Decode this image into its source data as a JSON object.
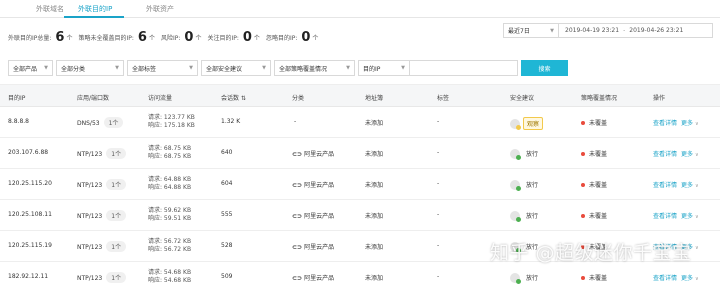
{
  "tabs": [
    "外联域名",
    "外联目的IP",
    "外联资产"
  ],
  "stats": [
    {
      "label": "外联目的IP总量:",
      "value": "6",
      "unit": "个"
    },
    {
      "label": "策略未全覆盖目的IP:",
      "value": "6",
      "unit": "个"
    },
    {
      "label": "风险IP:",
      "value": "0",
      "unit": "个"
    },
    {
      "label": "关注目的IP:",
      "value": "0",
      "unit": "个"
    },
    {
      "label": "忽略目的IP:",
      "value": "0",
      "unit": "个"
    }
  ],
  "date_range": {
    "preset": "最近7日",
    "start": "2019-04-19 23:21",
    "end": "2019-04-26 23:21",
    "separator": "-"
  },
  "filters": {
    "items": [
      "全部产品",
      "全部分类",
      "全部标签",
      "全部安全建议",
      "全部策略覆盖情况",
      "目的IP"
    ],
    "search_label": "搜索",
    "input_value": ""
  },
  "table": {
    "headers": [
      "目的IP",
      "应用/端口数",
      "访问流量",
      "会话数",
      "分类",
      "地址簿",
      "标签",
      "安全建议",
      "策略覆盖情况",
      "操作"
    ],
    "sort_icon": "⇅",
    "rows": [
      {
        "ip": "8.8.8.8",
        "app": "DNS/53",
        "count": "1个",
        "req": "请求:  123.77 KB",
        "resp": "响应:  175.18 KB",
        "sessions": "1.32 K",
        "category_icon": "",
        "category": "-",
        "address": "未添加",
        "tag": "-",
        "advice": "观察",
        "advice_type": "warn",
        "coverage": "未覆盖",
        "detail": "查看详情",
        "more": "更多"
      },
      {
        "ip": "203.107.6.88",
        "app": "NTP/123",
        "count": "1个",
        "req": "请求:  68.75 KB",
        "resp": "响应:  68.75 KB",
        "sessions": "640",
        "category_icon": "⊂⊃",
        "category": "阿里云产品",
        "address": "未添加",
        "tag": "-",
        "advice": "放行",
        "advice_type": "ok",
        "coverage": "未覆盖",
        "detail": "查看详情",
        "more": "更多"
      },
      {
        "ip": "120.25.115.20",
        "app": "NTP/123",
        "count": "1个",
        "req": "请求:  64.88 KB",
        "resp": "响应:  64.88 KB",
        "sessions": "604",
        "category_icon": "⊂⊃",
        "category": "阿里云产品",
        "address": "未添加",
        "tag": "-",
        "advice": "放行",
        "advice_type": "ok",
        "coverage": "未覆盖",
        "detail": "查看详情",
        "more": "更多"
      },
      {
        "ip": "120.25.108.11",
        "app": "NTP/123",
        "count": "1个",
        "req": "请求:  59.62 KB",
        "resp": "响应:  59.51 KB",
        "sessions": "555",
        "category_icon": "⊂⊃",
        "category": "阿里云产品",
        "address": "未添加",
        "tag": "-",
        "advice": "放行",
        "advice_type": "ok",
        "coverage": "未覆盖",
        "detail": "查看详情",
        "more": "更多"
      },
      {
        "ip": "120.25.115.19",
        "app": "NTP/123",
        "count": "1个",
        "req": "请求:  56.72 KB",
        "resp": "响应:  56.72 KB",
        "sessions": "528",
        "category_icon": "⊂⊃",
        "category": "阿里云产品",
        "address": "未添加",
        "tag": "-",
        "advice": "放行",
        "advice_type": "ok",
        "coverage": "未覆盖",
        "detail": "查看详情",
        "more": "更多"
      },
      {
        "ip": "182.92.12.11",
        "app": "NTP/123",
        "count": "1个",
        "req": "请求:  54.68 KB",
        "resp": "响应:  54.68 KB",
        "sessions": "509",
        "category_icon": "⊂⊃",
        "category": "阿里云产品",
        "address": "未添加",
        "tag": "-",
        "advice": "放行",
        "advice_type": "ok",
        "coverage": "未覆盖",
        "detail": "查看详情",
        "more": "更多"
      }
    ]
  },
  "colors": {
    "accent": "#1aa3c8",
    "danger": "#e94b3c",
    "ok": "#4caf50",
    "warn": "#f2c94c"
  },
  "watermark": "知乎 @超级迷你千宝宝"
}
